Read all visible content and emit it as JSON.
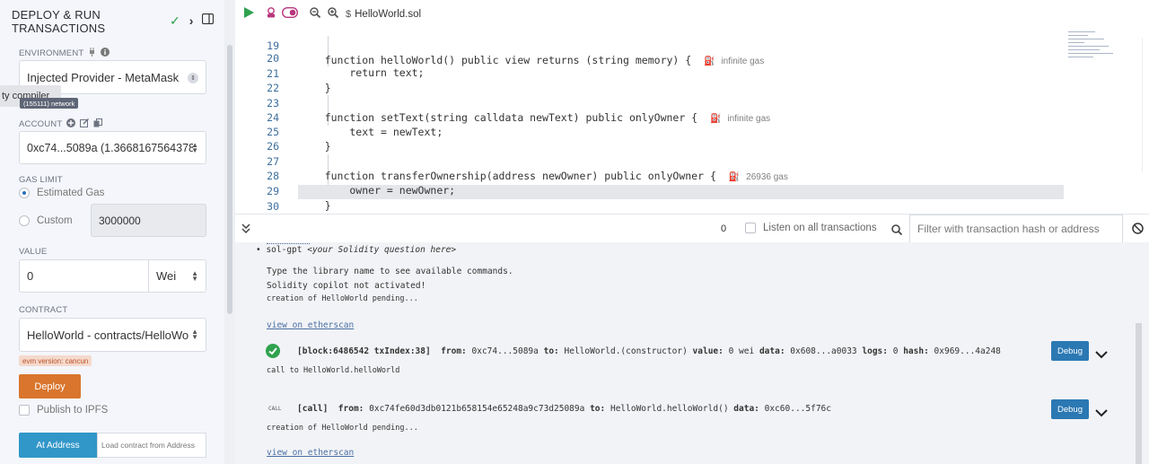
{
  "panel": {
    "title_line1": "DEPLOY & RUN",
    "title_line2": "TRANSACTIONS",
    "environment_label": "ENVIRONMENT",
    "environment_value": "Injected Provider - MetaMask",
    "tooltip": "ty compiler",
    "network_badge": "(155111) network",
    "account_label": "ACCOUNT",
    "account_value": "0xc74...5089a (1.366816756437876",
    "gas_limit_label": "GAS LIMIT",
    "gas_estimated": "Estimated Gas",
    "gas_custom": "Custom",
    "gas_custom_value": "3000000",
    "value_label": "VALUE",
    "value_amount": "0",
    "value_unit": "Wei",
    "contract_label": "CONTRACT",
    "contract_value": "HelloWorld - contracts/HelloWorld",
    "evm_badge": "evm version: cancun",
    "deploy_label": "Deploy",
    "publish_label": "Publish to IPFS",
    "at_address_label": "At Address",
    "load_contract_placeholder": "Load contract from Address"
  },
  "editor": {
    "tab_file": "HelloWorld.sol",
    "lines": [
      {
        "n": "19",
        "text": "    function helloWorld() public view returns (string memory) {",
        "gas": "infinite gas"
      },
      {
        "n": "20",
        "text": "        return text;",
        "gas": ""
      },
      {
        "n": "21",
        "text": "    }",
        "gas": ""
      },
      {
        "n": "22",
        "text": "",
        "gas": ""
      },
      {
        "n": "23",
        "text": "    function setText(string calldata newText) public onlyOwner {",
        "gas": "infinite gas"
      },
      {
        "n": "24",
        "text": "        text = newText;",
        "gas": ""
      },
      {
        "n": "25",
        "text": "    }",
        "gas": ""
      },
      {
        "n": "26",
        "text": "",
        "gas": ""
      },
      {
        "n": "27",
        "text": "    function transferOwnership(address newOwner) public onlyOwner {",
        "gas": "26936 gas"
      },
      {
        "n": "28",
        "text": "        owner = newOwner;",
        "gas": ""
      },
      {
        "n": "29",
        "text": "    }",
        "gas": ""
      },
      {
        "n": "30",
        "text": "}",
        "gas": ""
      }
    ]
  },
  "terminal_bar": {
    "pending_count": "0",
    "listen_label": "Listen on all transactions",
    "filter_placeholder": "Filter with transaction hash or address"
  },
  "terminal": {
    "sol_gpt_line": "sol-gpt",
    "sol_gpt_hint": "<your Solidity question here>",
    "library_hint": "Type the library name to see available commands.",
    "copilot_status": "Solidity copilot not activated!",
    "creation_pending_1": "creation of HelloWorld pending...",
    "etherscan_link_1": "view on etherscan",
    "tx1": {
      "block": "[block:6486542 txIndex:38]",
      "from_label": "from:",
      "from": "0xc74...5089a",
      "to_label": "to:",
      "to": "HelloWorld.(constructor)",
      "value_label": "value:",
      "value": "0 wei",
      "data_label": "data:",
      "data": "0x608...a0033",
      "logs_label": "logs:",
      "logs": "0",
      "hash_label": "hash:",
      "hash": "0x969...4a248"
    },
    "call_line": "call to HelloWorld.helloWorld",
    "call_tag": "CALL",
    "tx2": {
      "kind": "[call]",
      "from_label": "from:",
      "from": "0xc74fe60d3db0121b658154e65248a9c73d25089a",
      "to_label": "to:",
      "to": "HelloWorld.helloWorld()",
      "data_label": "data:",
      "data": "0xc60...5f76c"
    },
    "creation_pending_2": "creation of HelloWorld pending...",
    "etherscan_link_2": "view on etherscan",
    "debug_label": "Debug"
  },
  "colors": {
    "accent_blue": "#2b78b3",
    "deploy_orange": "#d9752d",
    "success_green": "#2fa24e"
  },
  "icons": [
    "check-icon",
    "chevron-right-icon",
    "sidebar-toggle-icon",
    "play-icon",
    "debug-robot-icon",
    "toggle-icon",
    "zoom-out-icon",
    "zoom-in-icon",
    "solidity-icon",
    "plug-icon",
    "info-icon",
    "plus-circle-icon",
    "edit-icon",
    "copy-icon",
    "gas-pump-icon",
    "chevrons-down-icon",
    "search-icon",
    "block-icon",
    "success-check-icon",
    "chevron-down-icon"
  ]
}
